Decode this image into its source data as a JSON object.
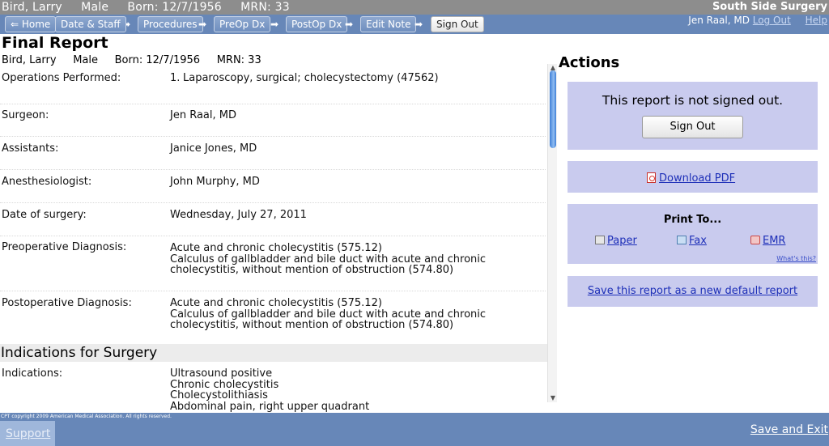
{
  "header": {
    "patient_line": "Bird, Larry     Male     Born: 12/7/1956     MRN: 33",
    "facility": "South Side Surgery"
  },
  "nav": {
    "items": [
      {
        "label": "⇐ Home"
      },
      {
        "label": "Date & Staff"
      },
      {
        "label": "Procedures"
      },
      {
        "label": "PreOp Dx"
      },
      {
        "label": "PostOp Dx"
      },
      {
        "label": "Edit Note"
      },
      {
        "label": "Sign Out"
      }
    ],
    "arrow": "➡",
    "user": "Jen Raal, MD",
    "logout": "Log Out",
    "help": "Help"
  },
  "report": {
    "title": "Final Report",
    "patient_line": "Bird, Larry     Male     Born: 12/7/1956     MRN: 33",
    "operations_label": "Operations Performed:",
    "operations": [
      {
        "num": "1.",
        "text": "Laparoscopy, surgical; cholecystectomy (47562)"
      }
    ],
    "surgeon_label": "Surgeon:",
    "surgeon": "Jen Raal, MD",
    "assistants_label": "Assistants:",
    "assistants": "Janice Jones, MD",
    "anesthesiologist_label": "Anesthesiologist:",
    "anesthesiologist": "John Murphy, MD",
    "date_label": "Date of surgery:",
    "date": "Wednesday, July 27, 2011",
    "preop_label": "Preoperative Diagnosis:",
    "preop_lines": [
      "Acute and chronic cholecystitis (575.12)",
      "Calculus of gallbladder and bile duct with acute and chronic",
      "cholecystitis, without mention of obstruction (574.80)"
    ],
    "postop_label": "Postoperative Diagnosis:",
    "postop_lines": [
      "Acute and chronic cholecystitis (575.12)",
      "Calculus of gallbladder and bile duct with acute and chronic",
      "cholecystitis, without mention of obstruction (574.80)"
    ],
    "indications_heading": "Indications for Surgery",
    "indications_label": "Indications:",
    "indications_lines": [
      "Ultrasound positive",
      "Chronic cholecystitis",
      "Cholecystolithiasis",
      "Abdominal pain, right upper quadrant"
    ]
  },
  "actions": {
    "title": "Actions",
    "status_message": "This report is not signed out.",
    "sign_out_button": "Sign Out",
    "download_pdf": "Download PDF",
    "print_to": "Print To...",
    "print_paper": "Paper",
    "print_fax": "Fax",
    "print_emr": "EMR",
    "whats_this": "What's this?",
    "save_default": "Save this report as a new default report"
  },
  "footer": {
    "copyright": "CPT copyright 2009 American Medical Association. All rights reserved.",
    "support": "Support",
    "save_exit": "Save and Exit"
  },
  "colors": {
    "nav_bar": "#6787b8",
    "patient_bar": "#8d8d8d",
    "action_box": "#c9cbee",
    "link": "#1d2fb8"
  }
}
